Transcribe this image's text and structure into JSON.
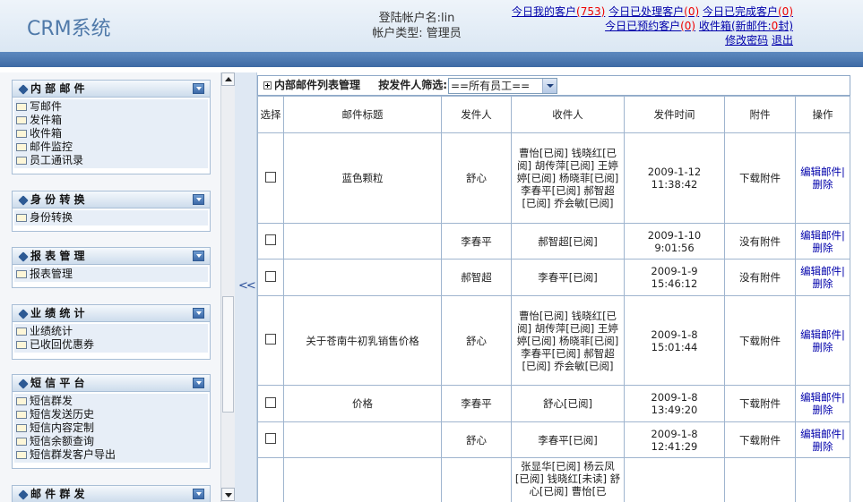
{
  "header": {
    "logo": "CRM系统",
    "account_label": "登陆帐户名:lin",
    "account_type": "帐户类型: 管理员",
    "links": {
      "today_my_customers": "今日我的客户",
      "today_my_count": "(753)",
      "today_handled": "今日已处理客户",
      "today_handled_count": "(0)",
      "today_done": "今日已完成客户",
      "today_done_count": "(0)",
      "today_reserved": "今日已预约客户",
      "today_reserved_count": "(0)",
      "inbox": "收件箱",
      "new_mail": "(新邮件:",
      "new_mail_count": "0",
      "new_mail_suffix": "封)",
      "change_password": "修改密码",
      "logout": "退出"
    }
  },
  "sidebar": {
    "sections": [
      {
        "title": "内 部 邮 件",
        "items": [
          "写邮件",
          "发件箱",
          "收件箱",
          "邮件监控",
          "员工通讯录"
        ]
      },
      {
        "title": "身 份 转 换",
        "items": [
          "身份转换"
        ]
      },
      {
        "title": "报 表 管 理",
        "items": [
          "报表管理"
        ]
      },
      {
        "title": "业 绩 统 计",
        "items": [
          "业绩统计",
          "已收回优惠券"
        ]
      },
      {
        "title": "短 信 平 台",
        "items": [
          "短信群发",
          "短信发送历史",
          "短信内容定制",
          "短信余额查询",
          "短信群发客户导出"
        ]
      },
      {
        "title": "邮 件 群 发",
        "items": []
      }
    ]
  },
  "splitter_label": "<<",
  "toolbar": {
    "title": "内部邮件列表管理",
    "filter_label": "按发件人筛选:",
    "filter_value": "==所有员工=="
  },
  "table": {
    "headers": [
      "选择",
      "邮件标题",
      "发件人",
      "收件人",
      "发件时间",
      "附件",
      "操作"
    ],
    "rows": [
      {
        "title": "蓝色颗粒",
        "sender": "舒心",
        "recipients": "曹怡[已阅] 钱晓红[已阅] 胡传萍[已阅] 王婷婷[已阅] 杨晓菲[已阅] 李春平[已阅] 郝智超[已阅] 乔会敏[已阅]",
        "time": "2009-1-12 11:38:42",
        "attachment": "下载附件"
      },
      {
        "title": "",
        "sender": "李春平",
        "recipients": "郝智超[已阅]",
        "time": "2009-1-10 9:01:56",
        "attachment": "没有附件"
      },
      {
        "title": "",
        "sender": "郝智超",
        "recipients": "李春平[已阅]",
        "time": "2009-1-9 15:46:12",
        "attachment": "没有附件"
      },
      {
        "title": "关于苍南牛初乳销售价格",
        "sender": "舒心",
        "recipients": "曹怡[已阅] 钱晓红[已阅] 胡传萍[已阅] 王婷婷[已阅] 杨晓菲[已阅] 李春平[已阅] 郝智超[已阅] 乔会敏[已阅]",
        "time": "2009-1-8 15:01:44",
        "attachment": "下载附件"
      },
      {
        "title": "价格",
        "sender": "李春平",
        "recipients": "舒心[已阅]",
        "time": "2009-1-8 13:49:20",
        "attachment": "下载附件"
      },
      {
        "title": "",
        "sender": "舒心",
        "recipients": "李春平[已阅]",
        "time": "2009-1-8 12:41:29",
        "attachment": "下载附件"
      },
      {
        "title": "",
        "sender": "",
        "recipients": "张显华[已阅] 杨云凤[已阅] 钱晓红[未读] 舒心[已阅] 曹怡[已",
        "time": "",
        "attachment": ""
      }
    ],
    "edit_label": "编辑邮件|",
    "delete_label": "删除"
  }
}
